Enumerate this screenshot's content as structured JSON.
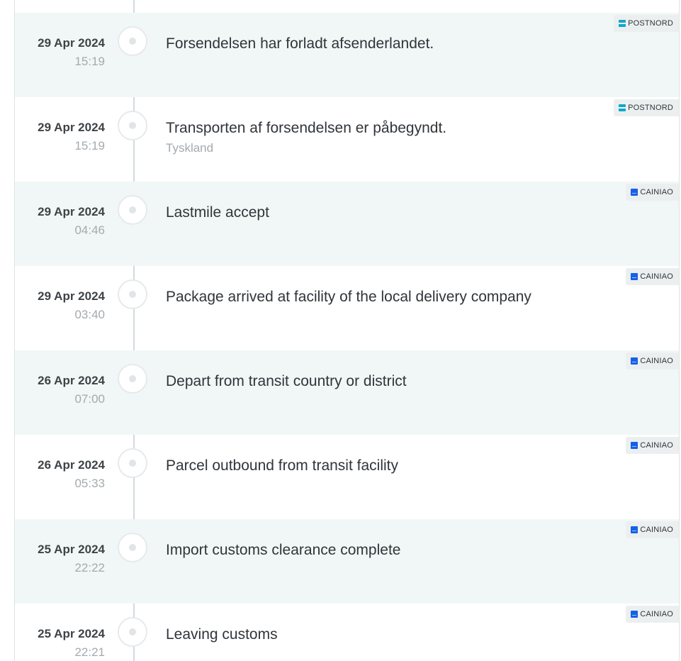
{
  "events": [
    {
      "date": "29 Apr 2024",
      "time": "15:19",
      "message": "Forsendelsen har forladt afsenderlandet.",
      "location": "",
      "carrier": "POSTNORD",
      "carrier_icon": "postnord-logo-icon",
      "carrier_color": "#0fa8c9",
      "shaded": true
    },
    {
      "date": "29 Apr 2024",
      "time": "15:19",
      "message": "Transporten af forsendelsen er påbegyndt.",
      "location": "Tyskland",
      "carrier": "POSTNORD",
      "carrier_icon": "postnord-logo-icon",
      "carrier_color": "#0fa8c9",
      "shaded": false
    },
    {
      "date": "29 Apr 2024",
      "time": "04:46",
      "message": "Lastmile accept",
      "location": "",
      "carrier": "CAINIAO",
      "carrier_icon": "cainiao-logo-icon",
      "carrier_color": "#1560e6",
      "shaded": true
    },
    {
      "date": "29 Apr 2024",
      "time": "03:40",
      "message": "Package arrived at facility of the local delivery company",
      "location": "",
      "carrier": "CAINIAO",
      "carrier_icon": "cainiao-logo-icon",
      "carrier_color": "#1560e6",
      "shaded": false
    },
    {
      "date": "26 Apr 2024",
      "time": "07:00",
      "message": "Depart from transit country or district",
      "location": "",
      "carrier": "CAINIAO",
      "carrier_icon": "cainiao-logo-icon",
      "carrier_color": "#1560e6",
      "shaded": true
    },
    {
      "date": "26 Apr 2024",
      "time": "05:33",
      "message": "Parcel outbound from transit facility",
      "location": "",
      "carrier": "CAINIAO",
      "carrier_icon": "cainiao-logo-icon",
      "carrier_color": "#1560e6",
      "shaded": false
    },
    {
      "date": "25 Apr 2024",
      "time": "22:22",
      "message": "Import customs clearance complete",
      "location": "",
      "carrier": "CAINIAO",
      "carrier_icon": "cainiao-logo-icon",
      "carrier_color": "#1560e6",
      "shaded": true
    },
    {
      "date": "25 Apr 2024",
      "time": "22:21",
      "message": "Leaving customs",
      "location": "",
      "carrier": "CAINIAO",
      "carrier_icon": "cainiao-logo-icon",
      "carrier_color": "#1560e6",
      "shaded": false
    }
  ],
  "colors": {
    "shaded_row": "#f1f7f7",
    "timeline_line": "#d3d9dc",
    "text_primary": "#30353a",
    "text_muted": "#a3aaae"
  }
}
